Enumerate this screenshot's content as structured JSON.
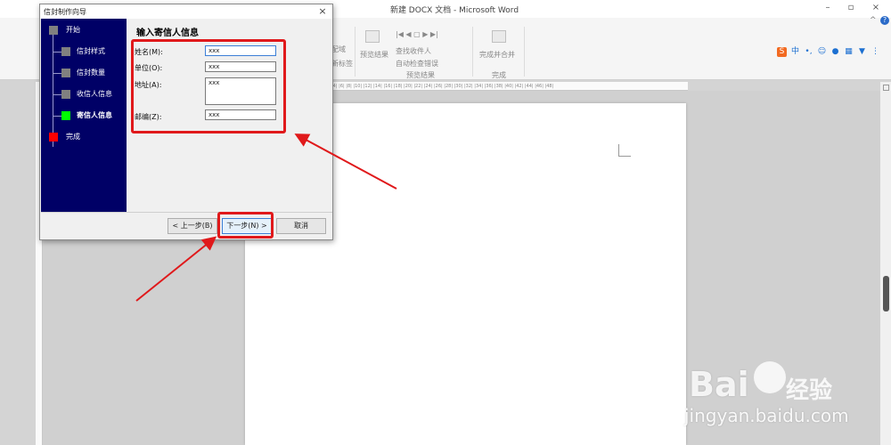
{
  "word": {
    "title": "新建 DOCX 文档 - Microsoft Word",
    "window_buttons": [
      "?",
      "▫",
      "×"
    ],
    "ribbon": {
      "items": [
        "配域",
        "新标签",
        "预览结果",
        "查找收件人",
        "自动检查错误",
        "完成并合并"
      ],
      "groups": [
        "预览结果",
        "完成"
      ]
    },
    "ruler_text": "|4| |6| |8| |10| |12| |14| |16| |18| |20| |22| |24| |26| |28| |30| |32| |34| |36| |38| |40| |42| |44| |46| |48|"
  },
  "ime_icons": [
    "S",
    "中",
    "•,",
    "☺",
    "🎤",
    "⌨",
    "👕",
    "⋯"
  ],
  "dialog": {
    "title": "信封制作向导",
    "heading": "输入寄信人信息",
    "steps": [
      {
        "label": "开始",
        "color": "#808080"
      },
      {
        "label": "信封样式",
        "color": "#808080"
      },
      {
        "label": "信封数量",
        "color": "#808080"
      },
      {
        "label": "收信人信息",
        "color": "#808080"
      },
      {
        "label": "寄信人信息",
        "color": "#00ff00"
      },
      {
        "label": "完成",
        "color": "#ff0000"
      }
    ],
    "fields": {
      "name_label": "姓名(M):",
      "name_value": "xxx",
      "company_label": "单位(O):",
      "company_value": "xxx",
      "address_label": "地址(A):",
      "address_value": "xxx",
      "postcode_label": "邮编(Z):",
      "postcode_value": "xxx"
    },
    "buttons": {
      "prev": "< 上一步(B)",
      "next": "下一步(N) >",
      "cancel": "取消"
    },
    "close": "×"
  },
  "watermark": {
    "logo": "Bai",
    "suffix": "经验",
    "url": "jingyan.baidu.com"
  },
  "colors": {
    "sidebar": "#000066",
    "annotation": "#e0191b",
    "current_step": "#00ff00",
    "final_step": "#ff0000"
  }
}
